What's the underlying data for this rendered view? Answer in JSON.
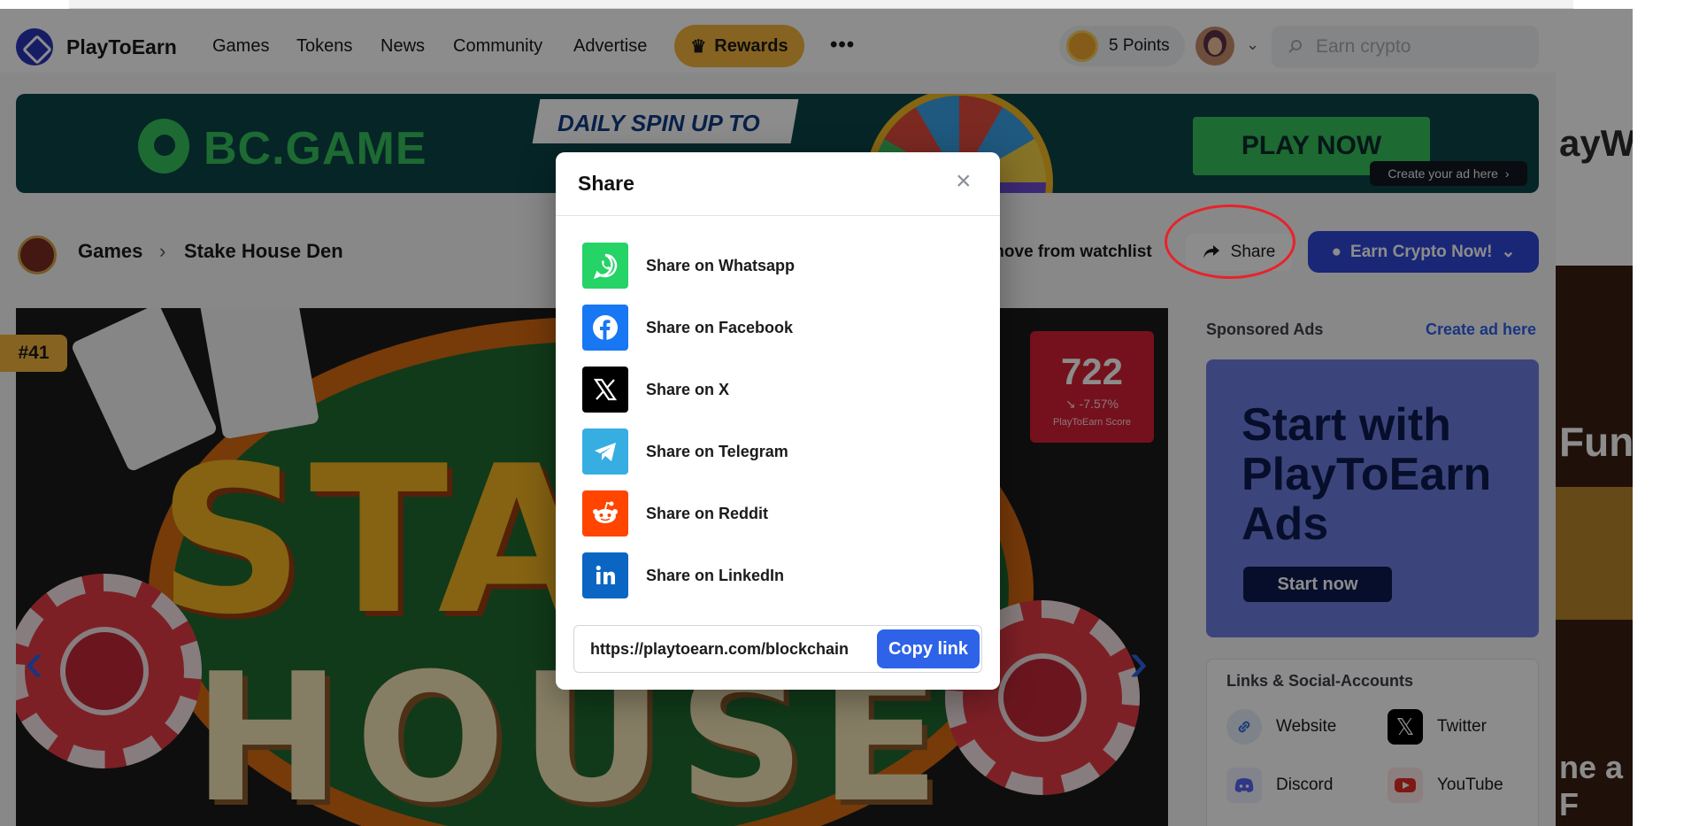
{
  "header": {
    "logo_text": "PlayToEarn",
    "nav": [
      "Games",
      "Tokens",
      "News",
      "Community",
      "Advertise"
    ],
    "rewards_label": "Rewards",
    "more_label": "•••",
    "points_label": "5 Points",
    "search_placeholder": "Earn crypto"
  },
  "banner": {
    "brand": "BC.GAME",
    "headline": "DAILY SPIN UP TO",
    "cta": "PLAY NOW",
    "create_ad": "Create your ad here"
  },
  "breadcrumb": {
    "root": "Games",
    "current": "Stake House Den"
  },
  "actions": {
    "watchlist": "move from watchlist",
    "share": "Share",
    "earn": "Earn Crypto Now!"
  },
  "hero": {
    "rank": "#41",
    "score": "722",
    "score_delta": "↘ -7.57%",
    "score_label": "PlayToEarn Score",
    "title_top": "STA",
    "title_bottom": "HOUSE"
  },
  "sidebar": {
    "sponsored_label": "Sponsored Ads",
    "create_ad": "Create ad here",
    "ad_headline": "Start with PlayToEarn Ads",
    "ad_cta": "Start now",
    "links_title": "Links & Social-Accounts",
    "links": [
      {
        "label": "Website",
        "icon": "link-icon",
        "color": "#2e6fd8"
      },
      {
        "label": "Twitter",
        "icon": "x-icon",
        "color": "#000000"
      },
      {
        "label": "Discord",
        "icon": "discord-icon",
        "color": "#5865f2"
      },
      {
        "label": "YouTube",
        "icon": "youtube-icon",
        "color": "#e52d27"
      }
    ]
  },
  "right_strip": {
    "text_top": "ayW",
    "text_mid": "Fun",
    "text_bottom": "ne a F"
  },
  "modal": {
    "title": "Share",
    "close": "×",
    "options": [
      {
        "label": "Share on Whatsapp",
        "icon": "whatsapp-icon",
        "color": "#25d366"
      },
      {
        "label": "Share on Facebook",
        "icon": "facebook-icon",
        "color": "#1877f2"
      },
      {
        "label": "Share on X",
        "icon": "x-icon",
        "color": "#000000"
      },
      {
        "label": "Share on Telegram",
        "icon": "telegram-icon",
        "color": "#37aee2"
      },
      {
        "label": "Share on Reddit",
        "icon": "reddit-icon",
        "color": "#ff4500"
      },
      {
        "label": "Share on LinkedIn",
        "icon": "linkedin-icon",
        "color": "#0a66c2"
      }
    ],
    "url": "https://playtoearn.com/blockchain",
    "copy_label": "Copy link"
  },
  "colors": {
    "accent": "#2e62e8",
    "rewards": "#f4b43c",
    "score_bg": "#d62035",
    "annotation_ring": "#e8222a"
  }
}
